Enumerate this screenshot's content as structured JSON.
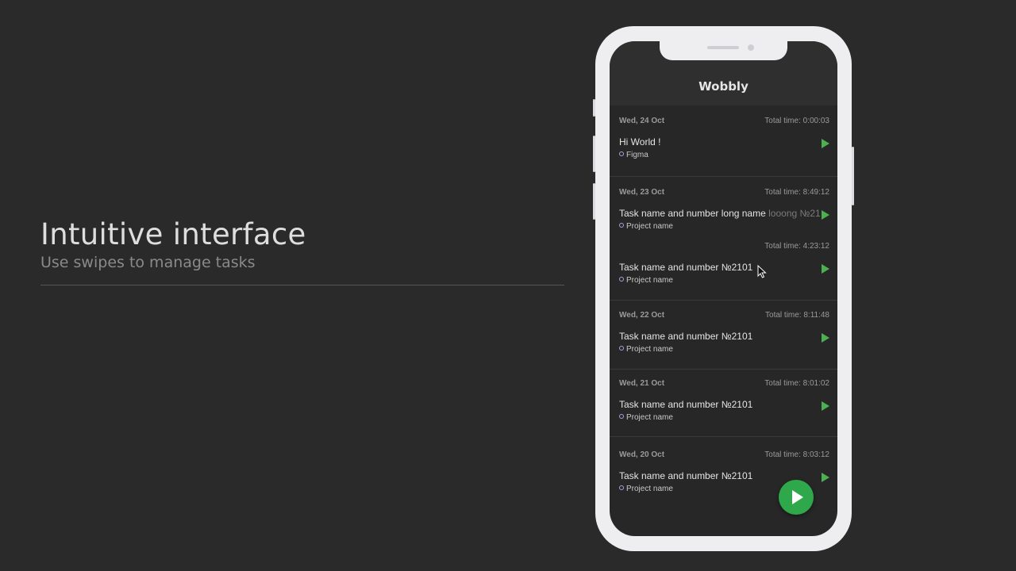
{
  "promo": {
    "title": "Intuitive interface",
    "subtitle": "Use swipes to manage tasks"
  },
  "app": {
    "title": "Wobbly"
  },
  "days": [
    {
      "date": "Wed, 24 Oct",
      "tasks": [
        {
          "total": "Total time: 0:00:03",
          "name": "Hi World !",
          "project": "Figma"
        }
      ]
    },
    {
      "date": "Wed, 23 Oct",
      "tasks": [
        {
          "total": "Total time: 8:49:12",
          "name": "Task name and number long name",
          "name_fade": "looong №21",
          "project": "Project name"
        },
        {
          "total": "Total time: 4:23:12",
          "name": "Task name and number №2101",
          "project": "Project name"
        }
      ]
    },
    {
      "date": "Wed, 22 Oct",
      "tasks": [
        {
          "total": "Total time: 8:11:48",
          "name": "Task name and number №2101",
          "project": "Project name"
        }
      ]
    },
    {
      "date": "Wed, 21 Oct",
      "tasks": [
        {
          "total": "Total time: 8:01:02",
          "name": "Task name and number №2101",
          "project": "Project name"
        }
      ]
    },
    {
      "date": "Wed, 20 Oct",
      "tasks": [
        {
          "total": "Total time: 8:03:12",
          "name": "Task name and number №2101",
          "project": "Project name"
        }
      ]
    }
  ],
  "colors": {
    "play": "#4caf50",
    "fab": "#2ea84a",
    "project_dot": "#b39ddb"
  },
  "icons": {
    "play": "play-icon",
    "fab": "play-icon",
    "project_dot": "dot-icon"
  }
}
